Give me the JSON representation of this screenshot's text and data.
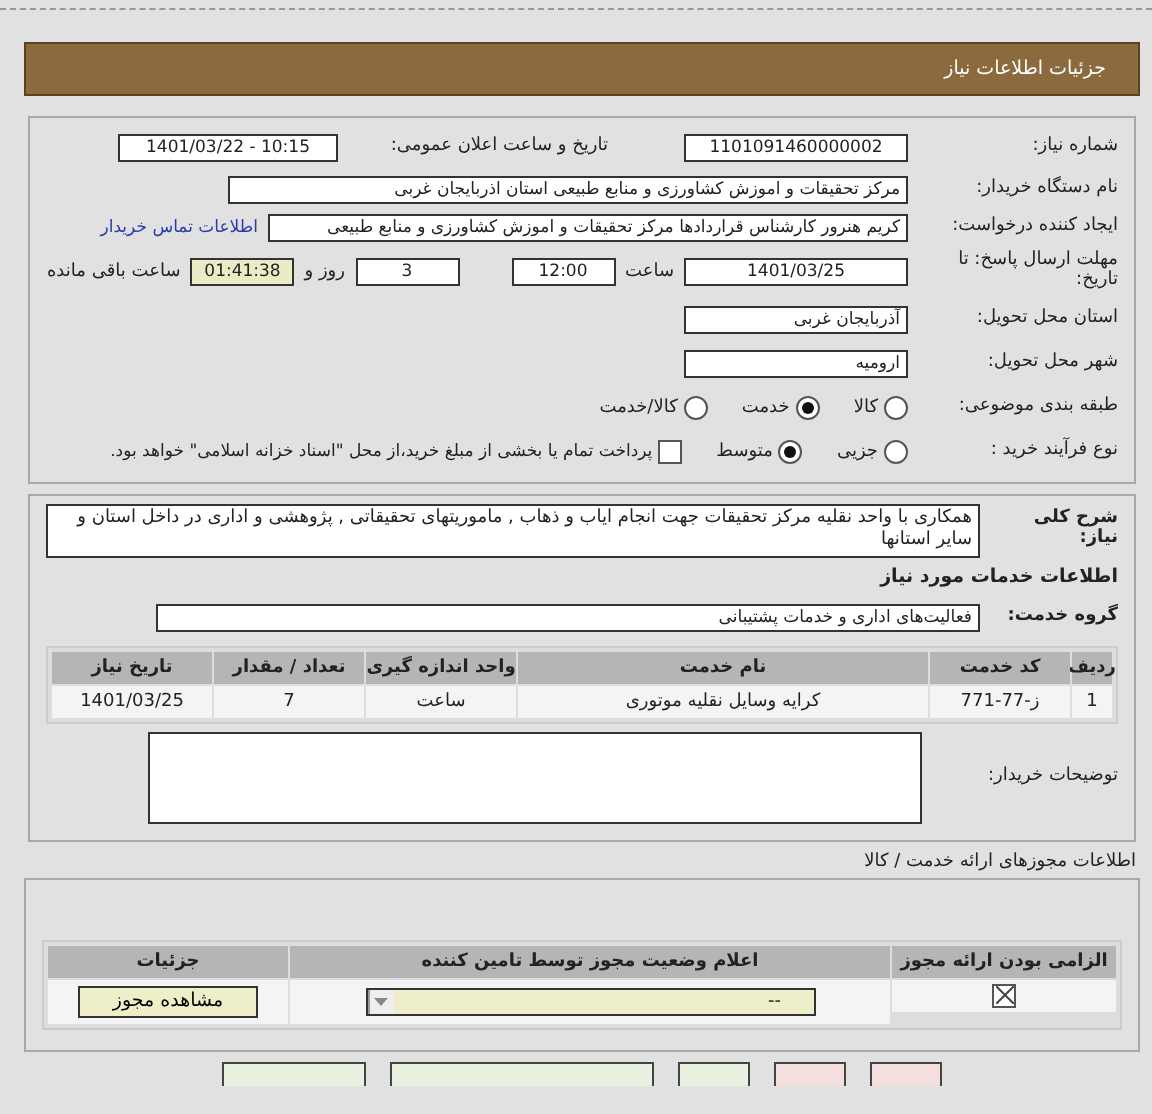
{
  "header": {
    "title": "جزئیات اطلاعات نیاز"
  },
  "need_number": {
    "label": "شماره نیاز:",
    "value": "1101091460000002"
  },
  "announce": {
    "label": "تاریخ و ساعت اعلان عمومی:",
    "value": "1401/03/22 - 10:15"
  },
  "buyer": {
    "label": "نام دستگاه خریدار:",
    "value": "مرکز تحقیقات و اموزش کشاورزی و منابع طبیعی استان اذربایجان غربی"
  },
  "creator": {
    "label": "ایجاد کننده درخواست:",
    "value": "کریم هنرور کارشناس قراردادها مرکز تحقیقات و اموزش کشاورزی و منابع طبیعی",
    "link": "اطلاعات تماس خریدار"
  },
  "deadline": {
    "label": "مهلت ارسال پاسخ: تا تاریخ:",
    "date": "1401/03/25",
    "time_label": "ساعت",
    "time": "12:00",
    "days": "3",
    "days_label": "روز و",
    "remaining": "01:41:38",
    "remaining_label": "ساعت باقی مانده"
  },
  "province": {
    "label": "استان محل تحویل:",
    "value": "آذربایجان غربی"
  },
  "city": {
    "label": "شهر محل تحویل:",
    "value": "ارومیه"
  },
  "category": {
    "label": "طبقه بندی موضوعی:",
    "options": [
      {
        "label": "کالا",
        "selected": false
      },
      {
        "label": "خدمت",
        "selected": true
      },
      {
        "label": "کالا/خدمت",
        "selected": false
      }
    ]
  },
  "process": {
    "label": "نوع فرآیند خرید :",
    "options": [
      {
        "label": "جزیی",
        "selected": false
      },
      {
        "label": "متوسط",
        "selected": true
      }
    ],
    "treasury": {
      "label": "پرداخت تمام یا بخشی از مبلغ خرید،از محل \"اسناد خزانه اسلامی\" خواهد بود.",
      "checked": false
    }
  },
  "description": {
    "label": "شرح کلی نیاز:",
    "value": "همکاری با واحد نقلیه مرکز تحقیقات جهت انجام ایاب و ذهاب , ماموریتهای تحقیقاتی , پژوهشی و اداری در داخل استان و سایر استانها"
  },
  "services": {
    "title": "اطلاعات خدمات مورد نیاز",
    "group_label": "گروه خدمت:",
    "group": "فعالیت‌های اداری و خدمات پشتیبانی",
    "columns": [
      "ردیف",
      "کد خدمت",
      "نام خدمت",
      "واحد اندازه گیری",
      "تعداد / مقدار",
      "تاریخ نیاز"
    ],
    "rows": [
      [
        "1",
        "ز-77-771",
        "کرایه وسایل نقلیه موتوری",
        "ساعت",
        "7",
        "1401/03/25"
      ]
    ]
  },
  "buyer_notes": {
    "label": "توضیحات خریدار:"
  },
  "licenses": {
    "title": "اطلاعات مجوزهای ارائه خدمت / کالا",
    "columns": [
      "الزامی بودن ارائه مجوز",
      "اعلام وضعیت مجوز توسط تامین کننده",
      "جزئیات"
    ],
    "rows": [
      {
        "required": true,
        "status": "--",
        "action": "مشاهده مجوز"
      }
    ]
  },
  "bottom_buttons": [
    {
      "color": "#f4dede"
    },
    {
      "color": "#f4dede"
    },
    {
      "color": "#e8f0e0"
    },
    {
      "color": "#e8f0e0"
    },
    {
      "color": "#e8f0e0"
    }
  ]
}
